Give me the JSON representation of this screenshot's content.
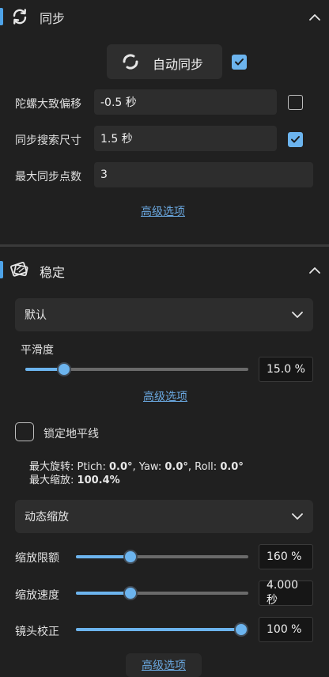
{
  "colors": {
    "accent": "#4ea3e8",
    "checkbox_on": "#6cb4ee",
    "link": "#6aa8e0",
    "bg": "#202020"
  },
  "sync": {
    "title": "同步",
    "auto_sync_label": "自动同步",
    "auto_sync_checked": true,
    "gyro_offset": {
      "label": "陀螺大致偏移",
      "value": "-0.5 秒",
      "checked": false
    },
    "search_size": {
      "label": "同步搜索尺寸",
      "value": "1.5 秒",
      "checked": true
    },
    "max_points": {
      "label": "最大同步点数",
      "value": "3"
    },
    "advanced_label": "高级选项"
  },
  "stabilization": {
    "title": "稳定",
    "method": "默认",
    "smoothness": {
      "label": "平滑度",
      "value": "15.0 %",
      "level": 0.15
    },
    "advanced_label": "高级选项",
    "lock_horizon": {
      "label": "锁定地平线",
      "checked": false
    },
    "info": {
      "max_rotation_label": "最大旋转:",
      "pitch_label": "Ptich:",
      "pitch_value": "0.0°",
      "yaw_label": "Yaw:",
      "yaw_value": "0.0°",
      "roll_label": "Roll:",
      "roll_value": "0.0°",
      "max_zoom_label": "最大缩放:",
      "max_zoom_value": "100.4%"
    },
    "zoom_mode": "动态缩放",
    "zoom_limit": {
      "label": "缩放限额",
      "value": "160 %",
      "level": 0.3
    },
    "zoom_speed": {
      "label": "缩放速度",
      "value": "4.000 秒",
      "level": 0.3
    },
    "lens_correction": {
      "label": "镜头校正",
      "value": "100 %",
      "level": 1.0
    },
    "advanced_label_2": "高级选项"
  }
}
